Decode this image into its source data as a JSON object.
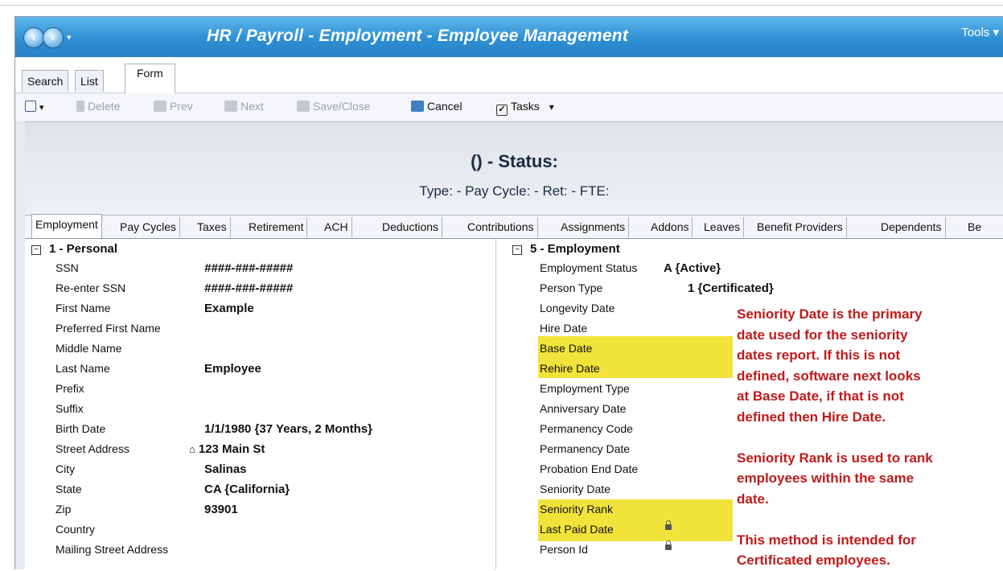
{
  "window": {
    "title": "HR / Payroll - Employment - Employee Management",
    "tools_label": "Tools ▾",
    "nav_dropdown": "▾"
  },
  "view_tabs": [
    "Search",
    "List",
    "Form"
  ],
  "toolbar": {
    "delete": "Delete",
    "prev": "Prev",
    "next": "Next",
    "save_close": "Save/Close",
    "cancel": "Cancel",
    "tasks": "Tasks",
    "tasks_dropdown": "▾",
    "find_dropdown": "▾"
  },
  "header": {
    "status_title": "() - Status:",
    "status_sub": "Type:  - Pay Cycle:  - Ret:  - FTE:"
  },
  "form_tabs": [
    "Employment",
    "Pay Cycles",
    "Taxes",
    "Retirement",
    "ACH",
    "Deductions",
    "Contributions",
    "Assignments",
    "Addons",
    "Leaves",
    "Benefit Providers",
    "Dependents",
    "Be"
  ],
  "personal": {
    "section_title": "1 - Personal",
    "collapse_glyph": "−",
    "rows": [
      {
        "label": "SSN",
        "value": "####-###-#####"
      },
      {
        "label": "Re-enter SSN",
        "value": "####-###-#####"
      },
      {
        "label": "First Name",
        "value": "Example"
      },
      {
        "label": "Preferred First Name",
        "value": ""
      },
      {
        "label": "Middle Name",
        "value": ""
      },
      {
        "label": "Last Name",
        "value": "Employee"
      },
      {
        "label": "Prefix",
        "value": ""
      },
      {
        "label": "Suffix",
        "value": ""
      },
      {
        "label": "Birth Date",
        "value": "1/1/1980 {37 Years, 2 Months}"
      },
      {
        "label": "Street Address",
        "value": "123 Main St"
      },
      {
        "label": "City",
        "value": "Salinas"
      },
      {
        "label": "State",
        "value": "CA {California}"
      },
      {
        "label": "Zip",
        "value": "93901"
      },
      {
        "label": "Country",
        "value": ""
      },
      {
        "label": "Mailing Street Address",
        "value": ""
      }
    ]
  },
  "employment": {
    "section_title": "5 - Employment",
    "collapse_glyph": "−",
    "rows": [
      {
        "label": "Employment Status",
        "value": "A {Active}"
      },
      {
        "label": "Person Type",
        "value": "1 {Certificated}"
      },
      {
        "label": "Longevity Date",
        "value": ""
      },
      {
        "label": "Hire Date",
        "value": ""
      },
      {
        "label": "Base Date",
        "value": ""
      },
      {
        "label": "Rehire Date",
        "value": ""
      },
      {
        "label": "Employment Type",
        "value": ""
      },
      {
        "label": "Anniversary Date",
        "value": ""
      },
      {
        "label": "Permanency Code",
        "value": ""
      },
      {
        "label": "Permanency Date",
        "value": ""
      },
      {
        "label": "Probation End Date",
        "value": ""
      },
      {
        "label": "Seniority Date",
        "value": ""
      },
      {
        "label": "Seniority Rank",
        "value": ""
      },
      {
        "label": "Last Paid Date",
        "value": ""
      },
      {
        "label": "Person Id",
        "value": ""
      }
    ]
  },
  "annotation": {
    "lines": [
      "Seniority Date is the primary",
      "date used for the seniority",
      "dates report. If this is not",
      "defined, software next looks",
      "at Base Date, if that is not",
      "defined then Hire Date.",
      "",
      "Seniority Rank is used to rank",
      "employees within the same",
      "date.",
      "",
      "This method is intended for",
      "Certificated employees."
    ]
  },
  "colors": {
    "titlebar": "#2e8fd3",
    "highlight": "#f2e33a",
    "annotation_text": "#c01a1a"
  }
}
